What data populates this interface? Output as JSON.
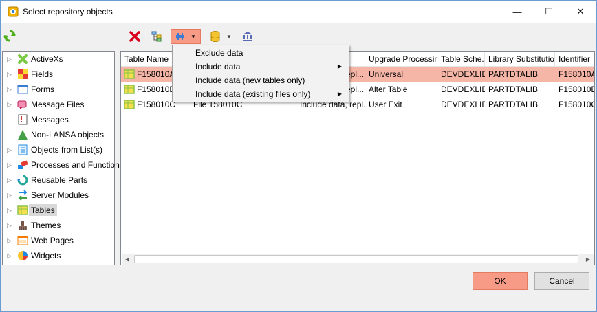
{
  "window": {
    "title": "Select repository objects",
    "min_glyph": "—",
    "max_glyph": "☐",
    "close_glyph": "✕"
  },
  "tree": {
    "items": [
      {
        "label": "ActiveXs",
        "icon": "activex-icon",
        "selected": false
      },
      {
        "label": "Fields",
        "icon": "fields-icon",
        "selected": false
      },
      {
        "label": "Forms",
        "icon": "forms-icon",
        "selected": false
      },
      {
        "label": "Message Files",
        "icon": "message-files-icon",
        "selected": false
      },
      {
        "label": "Messages",
        "icon": "messages-icon",
        "selected": false
      },
      {
        "label": "Non-LANSA objects",
        "icon": "non-lansa-icon",
        "selected": false
      },
      {
        "label": "Objects from List(s)",
        "icon": "objects-list-icon",
        "selected": false
      },
      {
        "label": "Processes and Functions",
        "icon": "processes-icon",
        "selected": false
      },
      {
        "label": "Reusable Parts",
        "icon": "reusable-parts-icon",
        "selected": false
      },
      {
        "label": "Server Modules",
        "icon": "server-modules-icon",
        "selected": false
      },
      {
        "label": "Tables",
        "icon": "tables-icon",
        "selected": true
      },
      {
        "label": "Themes",
        "icon": "themes-icon",
        "selected": false
      },
      {
        "label": "Web Pages",
        "icon": "web-pages-icon",
        "selected": false
      },
      {
        "label": "Widgets",
        "icon": "widgets-icon",
        "selected": false
      }
    ]
  },
  "grid": {
    "columns": [
      "Table Name",
      "",
      "",
      "Upgrade Processing",
      "Table Sche...",
      "Library Substitution",
      "Identifier"
    ],
    "rows": [
      {
        "cells": [
          "F158010A",
          "",
          "",
          "Universal",
          "DEVDEXLIB",
          "PARTDTALIB",
          "F158010A"
        ],
        "partial": "epl...",
        "selected": true
      },
      {
        "cells": [
          "F158010B",
          "",
          "",
          "Alter Table",
          "DEVDEXLIB",
          "PARTDTALIB",
          "F158010B"
        ],
        "partial": "epl...",
        "selected": false
      },
      {
        "cells": [
          "F158010C",
          "File 158010C",
          "Include data, repl...",
          "User Exit",
          "DEVDEXLIB",
          "PARTDTALIB",
          "F158010C"
        ],
        "partial": "",
        "selected": false
      }
    ]
  },
  "menu": {
    "items": [
      {
        "label": "Exclude data",
        "submenu": false
      },
      {
        "label": "Include data",
        "submenu": true
      },
      {
        "label": "Include data (new tables only)",
        "submenu": false
      },
      {
        "label": "Include data (existing files only)",
        "submenu": true
      }
    ]
  },
  "buttons": {
    "ok": "OK",
    "cancel": "Cancel"
  },
  "colors": {
    "accent": "#f79b86",
    "selected_row": "#f6b6a7"
  }
}
